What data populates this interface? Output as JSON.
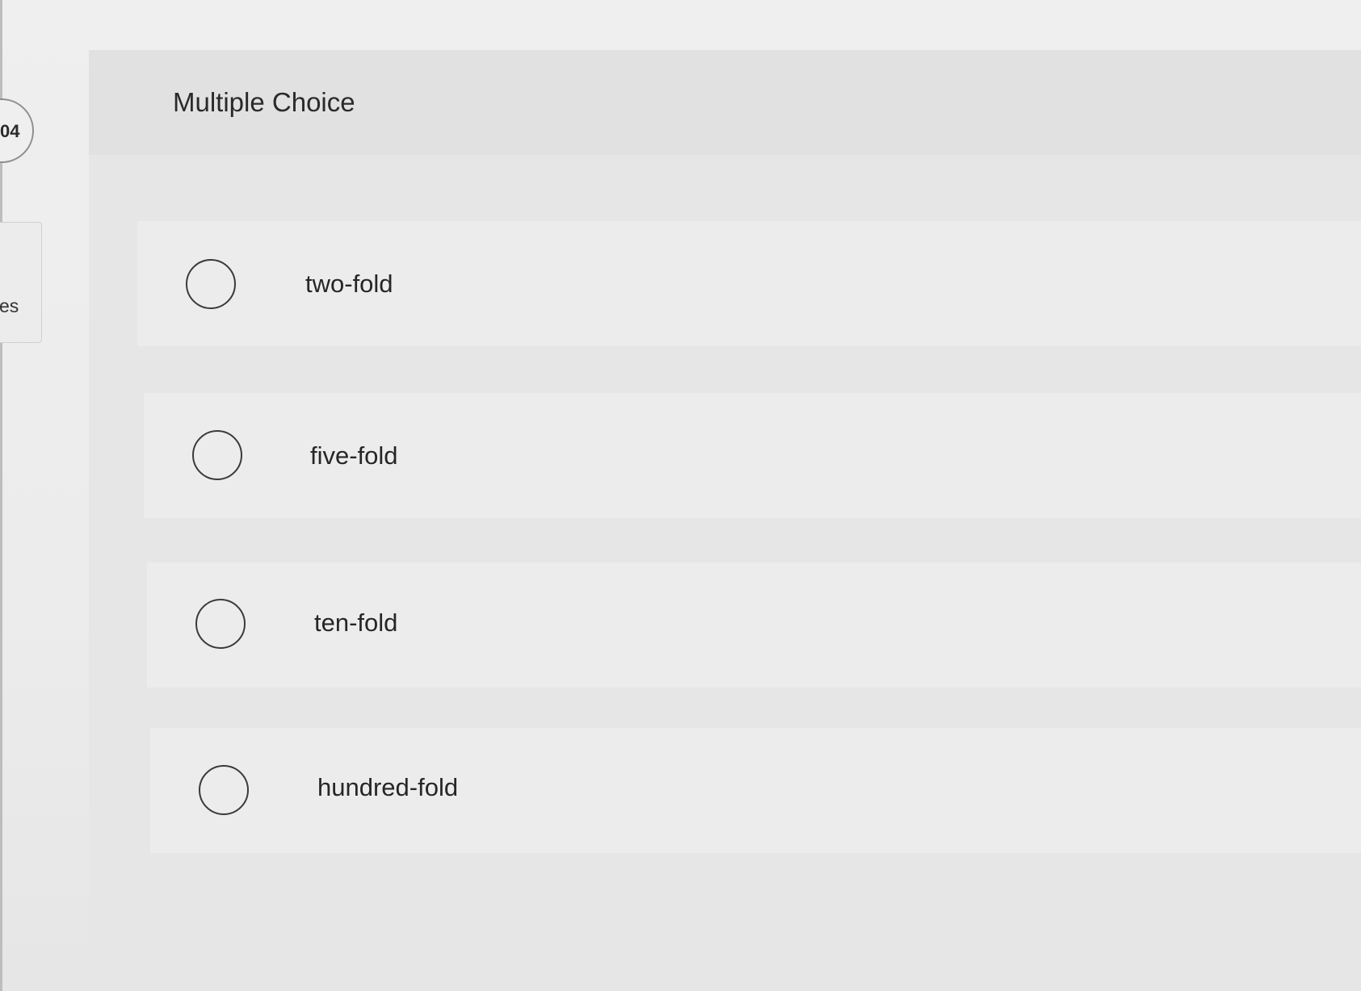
{
  "sidebar": {
    "question_number": "04",
    "card_text": "es"
  },
  "question": {
    "title": "Multiple Choice",
    "options": [
      {
        "label": "two-fold",
        "selected": false
      },
      {
        "label": "five-fold",
        "selected": false
      },
      {
        "label": "ten-fold",
        "selected": false
      },
      {
        "label": "hundred-fold",
        "selected": false
      }
    ]
  }
}
